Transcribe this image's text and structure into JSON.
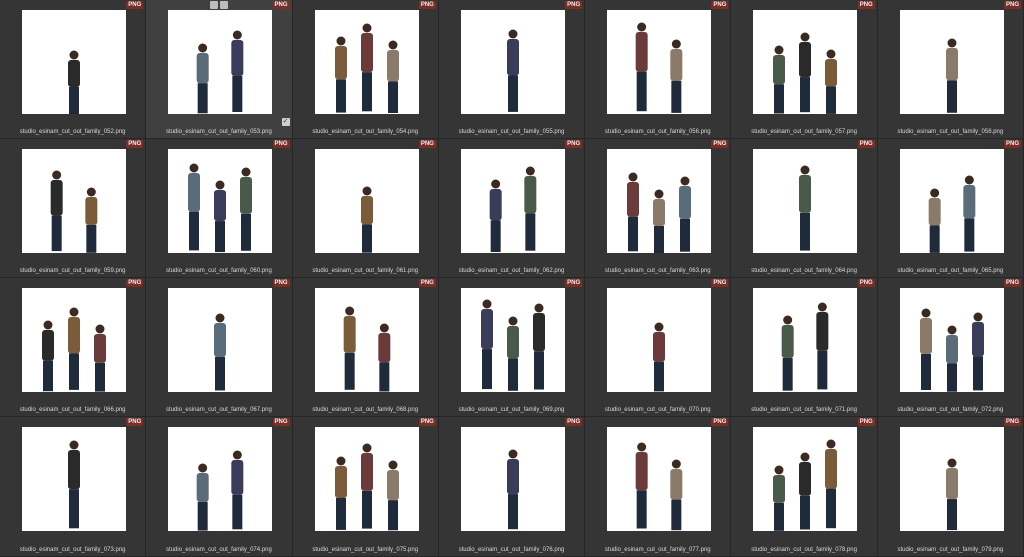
{
  "badge_label": "PNG",
  "checkmark_glyph": "✓",
  "colors": {
    "background": "#2f2f2f",
    "tile": "#353535",
    "thumbnail": "#ffffff",
    "badge": "#7b2d26",
    "filename_text": "#d8d8d8"
  },
  "files": [
    {
      "name": "studio_esinam_cut_out_family_052.png"
    },
    {
      "name": "studio_esinam_cut_out_family_053.png",
      "selected": true
    },
    {
      "name": "studio_esinam_cut_out_family_054.png"
    },
    {
      "name": "studio_esinam_cut_out_family_055.png"
    },
    {
      "name": "studio_esinam_cut_out_family_056.png"
    },
    {
      "name": "studio_esinam_cut_out_family_057.png"
    },
    {
      "name": "studio_esinam_cut_out_family_058.png"
    },
    {
      "name": "studio_esinam_cut_out_family_059.png"
    },
    {
      "name": "studio_esinam_cut_out_family_060.png"
    },
    {
      "name": "studio_esinam_cut_out_family_061.png"
    },
    {
      "name": "studio_esinam_cut_out_family_062.png"
    },
    {
      "name": "studio_esinam_cut_out_family_063.png"
    },
    {
      "name": "studio_esinam_cut_out_family_064.png"
    },
    {
      "name": "studio_esinam_cut_out_family_065.png"
    },
    {
      "name": "studio_esinam_cut_out_family_066.png"
    },
    {
      "name": "studio_esinam_cut_out_family_067.png"
    },
    {
      "name": "studio_esinam_cut_out_family_068.png"
    },
    {
      "name": "studio_esinam_cut_out_family_069.png"
    },
    {
      "name": "studio_esinam_cut_out_family_070.png"
    },
    {
      "name": "studio_esinam_cut_out_family_071.png"
    },
    {
      "name": "studio_esinam_cut_out_family_072.png"
    },
    {
      "name": "studio_esinam_cut_out_family_073.png"
    },
    {
      "name": "studio_esinam_cut_out_family_074.png"
    },
    {
      "name": "studio_esinam_cut_out_family_075.png"
    },
    {
      "name": "studio_esinam_cut_out_family_076.png"
    },
    {
      "name": "studio_esinam_cut_out_family_077.png"
    },
    {
      "name": "studio_esinam_cut_out_family_078.png"
    },
    {
      "name": "studio_esinam_cut_out_family_079.png"
    }
  ]
}
